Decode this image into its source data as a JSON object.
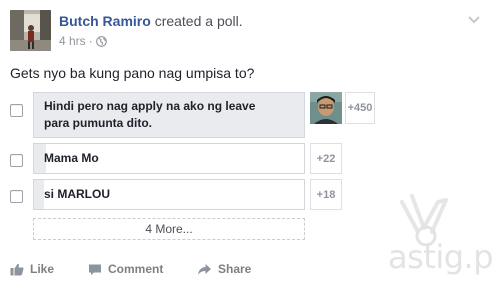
{
  "post": {
    "author": "Butch Ramiro",
    "action": "created a poll.",
    "time": "4 hrs",
    "dot": "·",
    "audience_icon": "globe-icon",
    "question": "Gets nyo ba kung pano nag umpisa to?"
  },
  "poll": {
    "options": [
      {
        "label_lines": [
          "Hindi pero nag apply na ako ng leave",
          "para pumunta dito."
        ],
        "count": "+450",
        "fill_fraction": 1.0,
        "has_voter_avatar": true
      },
      {
        "label": "Mama Mo",
        "count": "+22",
        "fill_fraction": 0.05
      },
      {
        "label": "si MARLOU",
        "count": "+18",
        "fill_fraction": 0.04
      }
    ],
    "more_label": "4 More..."
  },
  "actions": {
    "like": "Like",
    "comment": "Comment",
    "share": "Share"
  },
  "watermark": {
    "text": "astig.ph"
  },
  "colors": {
    "author_link": "#365899",
    "poll_fill": "#e9ebee",
    "muted_text": "#90949c",
    "action_text": "#7f7f7f"
  }
}
